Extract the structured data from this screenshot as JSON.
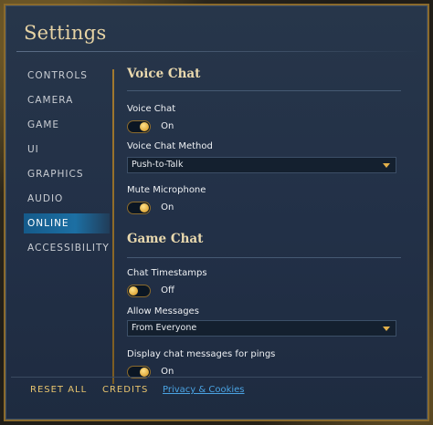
{
  "window": {
    "title": "Settings"
  },
  "nav": {
    "items": [
      {
        "label": "CONTROLS"
      },
      {
        "label": "CAMERA"
      },
      {
        "label": "GAME"
      },
      {
        "label": "UI"
      },
      {
        "label": "GRAPHICS"
      },
      {
        "label": "AUDIO"
      },
      {
        "label": "ONLINE",
        "active": true
      },
      {
        "label": "ACCESSIBILITY"
      }
    ]
  },
  "voice_chat": {
    "section_title": "Voice Chat",
    "voice_chat_label": "Voice Chat",
    "voice_chat_state": "On",
    "method_label": "Voice Chat Method",
    "method_value": "Push-to-Talk",
    "mute_label": "Mute Microphone",
    "mute_state": "On"
  },
  "game_chat": {
    "section_title": "Game Chat",
    "timestamps_label": "Chat Timestamps",
    "timestamps_state": "Off",
    "allow_label": "Allow Messages",
    "allow_value": "From Everyone",
    "pings_label": "Display chat messages for pings",
    "pings_state": "On"
  },
  "footer": {
    "reset_label": "RESET ALL",
    "credits_label": "CREDITS",
    "privacy_label": "Privacy & Cookies"
  },
  "colors": {
    "accent_gold": "#e3b04a",
    "active_nav": "#1c6fa3",
    "link": "#4aa3e3",
    "panel_bg": "#223047"
  }
}
